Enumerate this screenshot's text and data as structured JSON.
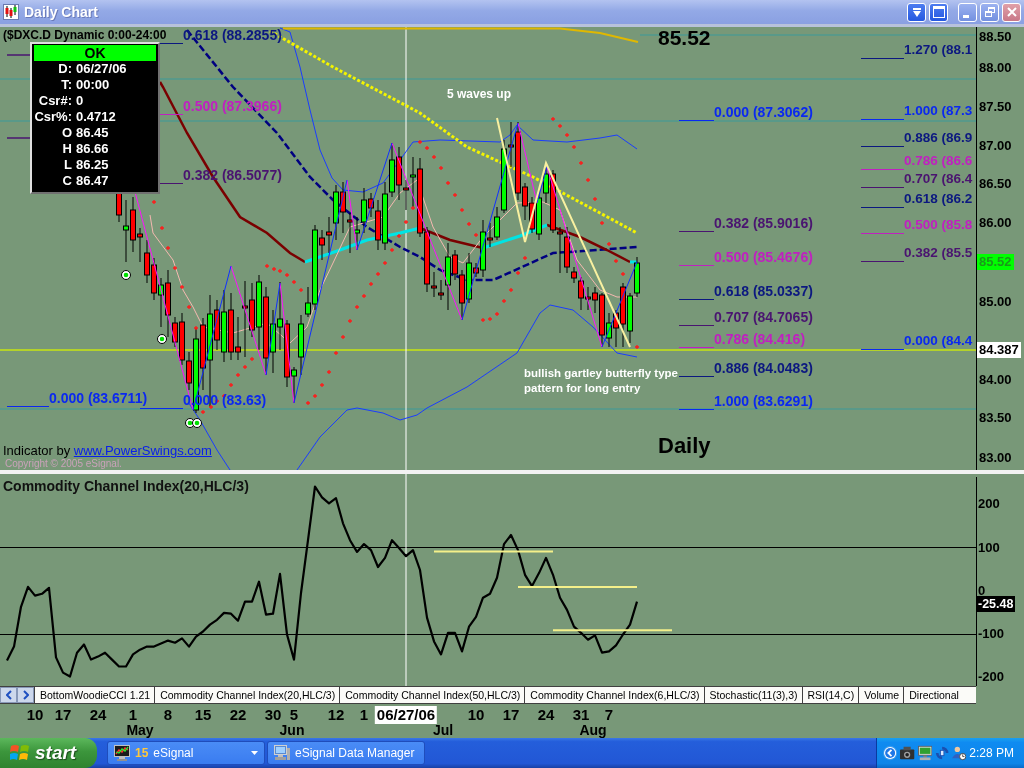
{
  "window": {
    "title": "Daily Chart"
  },
  "price_pane": {
    "symbol": "($DXC.D Dynamic 0:00-24:00",
    "last_price_label": "85.52",
    "data_window": {
      "header": "OK",
      "rows": [
        {
          "label": "D:",
          "value": "06/27/06"
        },
        {
          "label": "T:",
          "value": "00:00"
        },
        {
          "label": "Csr#:",
          "value": "0"
        },
        {
          "label": "Csr%:",
          "value": "0.4712"
        },
        {
          "label": "O",
          "value": "86.45"
        },
        {
          "label": "H",
          "value": "86.66"
        },
        {
          "label": "L",
          "value": "86.25"
        },
        {
          "label": "C",
          "value": "86.47"
        }
      ]
    },
    "fib_sets": [
      {
        "levels": [
          {
            "text": "0.618 (88.2855)",
            "color": "#0c1880"
          },
          {
            "text": "0.500 (87.3966)",
            "color": "#c020c0"
          },
          {
            "text": "0.382 (86.5077)",
            "color": "#4a1470"
          }
        ]
      },
      {
        "levels": [
          {
            "text": "0.000 (83.6711)",
            "color": "#0a28f0"
          }
        ]
      },
      {
        "levels": [
          {
            "text": "0.000 (83.63)",
            "color": "#0a28f0"
          }
        ]
      },
      {
        "levels": [
          {
            "text": "0.000 (87.3062)",
            "color": "#0a28f0"
          },
          {
            "text": "0.382 (85.9016)",
            "color": "#4a1470"
          },
          {
            "text": "0.500 (85.4676)",
            "color": "#c020c0"
          },
          {
            "text": "0.618 (85.0337)",
            "color": "#0c1880"
          },
          {
            "text": "0.707 (84.7065)",
            "color": "#4a1470"
          },
          {
            "text": "0.786 (84.416)",
            "color": "#c020c0"
          },
          {
            "text": "0.886 (84.0483)",
            "color": "#0c1880"
          },
          {
            "text": "1.000 (83.6291)",
            "color": "#0a28f0"
          }
        ]
      },
      {
        "levels": [
          {
            "text": "1.270 (88.1",
            "color": "#0c1880"
          },
          {
            "text": "1.000 (87.3",
            "color": "#0a28f0"
          },
          {
            "text": "0.886 (86.9",
            "color": "#0c1880"
          },
          {
            "text": "0.786 (86.6",
            "color": "#c020c0"
          },
          {
            "text": "0.707 (86.4",
            "color": "#4a1470"
          },
          {
            "text": "0.618 (86.2",
            "color": "#0c1880"
          },
          {
            "text": "0.500 (85.8",
            "color": "#c020c0"
          },
          {
            "text": "0.382 (85.5",
            "color": "#4a1470"
          },
          {
            "text": "0.000 (84.4",
            "color": "#0a28f0"
          }
        ]
      }
    ],
    "notes": [
      "5 waves up",
      "bullish gartley butterfly type pattern for long entry"
    ],
    "period_label": "Daily",
    "credit": {
      "text": "Indicator by",
      "link": "www.PowerSwings.com"
    },
    "copyright": "Copyright © 2005 eSignal.",
    "axis": {
      "ticks": [
        "88.50",
        "88.00",
        "87.50",
        "87.00",
        "86.50",
        "86.00",
        "85.00",
        "84.00",
        "83.50",
        "83.00"
      ],
      "last_price": "85.52",
      "level_price": "84.387"
    }
  },
  "cci_pane": {
    "axis": {
      "last_value": "-25.48"
    },
    "chart_data": {
      "type": "line",
      "title": "Commodity Channel Index(20,HLC/3)",
      "categories": [
        null,
        null,
        null,
        null,
        "10",
        null,
        null,
        null,
        "17",
        null,
        null,
        null,
        null,
        "24",
        null,
        null,
        null,
        null,
        "1",
        null,
        null,
        null,
        null,
        "8",
        null,
        null,
        null,
        null,
        "15",
        null,
        null,
        null,
        null,
        "22",
        null,
        null,
        null,
        null,
        "30",
        null,
        null,
        "5",
        null,
        null,
        null,
        null,
        null,
        "12",
        null,
        null,
        null,
        "1",
        null,
        null,
        null,
        null,
        null,
        null,
        null,
        null,
        null,
        null,
        null,
        null,
        null,
        null,
        null,
        "10",
        null,
        null,
        null,
        null,
        "17",
        null,
        null,
        null,
        null,
        "24",
        null,
        null,
        null,
        null,
        "31",
        null,
        null,
        null,
        "7",
        null,
        null,
        null,
        null,
        null,
        null,
        null,
        null,
        null
      ],
      "series": [
        {
          "color": "#000000",
          "values": [
            -161,
            -129,
            -37,
            9,
            -11,
            -7,
            7,
            -154,
            -189,
            -198,
            -143,
            -124,
            -159,
            -152,
            -143,
            -159,
            -175,
            -175,
            -147,
            -136,
            -129,
            -129,
            -122,
            -115,
            -120,
            -110,
            -129,
            -106,
            -94,
            -78,
            -67,
            -51,
            -53,
            -69,
            -25,
            -25,
            21,
            -55,
            -53,
            39,
            -101,
            -159,
            -5,
            117,
            241,
            216,
            202,
            214,
            156,
            117,
            90,
            108,
            94,
            55,
            76,
            117,
            99,
            80,
            94,
            48,
            -62,
            -117,
            -147,
            -97,
            -97,
            -140,
            -83,
            -60,
            -16,
            -7,
            30,
            108,
            129,
            94,
            37,
            11,
            41,
            76,
            37,
            -16,
            -44,
            -83,
            -97,
            -113,
            -103,
            -143,
            -140,
            -126,
            -101,
            -78,
            -25,
            null,
            null,
            null,
            null,
            null
          ]
        },
        {
          "color": "#f4f08a",
          "values": [
            null,
            null,
            null,
            null,
            null,
            null,
            null,
            null,
            null,
            null,
            null,
            null,
            null,
            null,
            null,
            null,
            null,
            null,
            null,
            null,
            null,
            null,
            null,
            null,
            null,
            null,
            null,
            null,
            null,
            null,
            null,
            null,
            null,
            null,
            null,
            null,
            null,
            null,
            null,
            null,
            null,
            null,
            null,
            null,
            null,
            null,
            null,
            null,
            null,
            null,
            null,
            null,
            null,
            null,
            null,
            null,
            null,
            null,
            null,
            null,
            null,
            91,
            91,
            91,
            91,
            91,
            91,
            91,
            91,
            91,
            91,
            91,
            91,
            91,
            91,
            91,
            91,
            91,
            91,
            null,
            null,
            null,
            null,
            null,
            null,
            null,
            null,
            null,
            null,
            null,
            null,
            null,
            null,
            null,
            null,
            null
          ]
        },
        {
          "color": "#f4f08a",
          "values": [
            null,
            null,
            null,
            null,
            null,
            null,
            null,
            null,
            null,
            null,
            null,
            null,
            null,
            null,
            null,
            null,
            null,
            null,
            null,
            null,
            null,
            null,
            null,
            null,
            null,
            null,
            null,
            null,
            null,
            null,
            null,
            null,
            null,
            null,
            null,
            null,
            null,
            null,
            null,
            null,
            null,
            null,
            null,
            null,
            null,
            null,
            null,
            null,
            null,
            null,
            null,
            null,
            null,
            null,
            null,
            null,
            null,
            null,
            null,
            null,
            null,
            null,
            null,
            null,
            null,
            null,
            null,
            null,
            null,
            null,
            null,
            null,
            null,
            9,
            9,
            9,
            9,
            9,
            9,
            9,
            9,
            9,
            9,
            9,
            9,
            9,
            9,
            9,
            9,
            9,
            9,
            null,
            null,
            null,
            null,
            null
          ]
        },
        {
          "color": "#f4f08a",
          "values": [
            null,
            null,
            null,
            null,
            null,
            null,
            null,
            null,
            null,
            null,
            null,
            null,
            null,
            null,
            null,
            null,
            null,
            null,
            null,
            null,
            null,
            null,
            null,
            null,
            null,
            null,
            null,
            null,
            null,
            null,
            null,
            null,
            null,
            null,
            null,
            null,
            null,
            null,
            null,
            null,
            null,
            null,
            null,
            null,
            null,
            null,
            null,
            null,
            null,
            null,
            null,
            null,
            null,
            null,
            null,
            null,
            null,
            null,
            null,
            null,
            null,
            null,
            null,
            null,
            null,
            null,
            null,
            null,
            null,
            null,
            null,
            null,
            null,
            null,
            null,
            null,
            null,
            null,
            -91,
            -91,
            -91,
            -91,
            -91,
            -91,
            -91,
            -91,
            -91,
            -91,
            -91,
            -91,
            -91,
            -91,
            -91,
            -91,
            -91,
            -91
          ]
        }
      ],
      "ylim": [
        -220,
        270
      ],
      "yticks": [
        {
          "value": 200,
          "label": "200"
        },
        {
          "value": 100,
          "label": "100"
        },
        {
          "value": 0,
          "label": "0"
        },
        {
          "value": -100,
          "label": "-100"
        },
        {
          "value": -200,
          "label": "-200"
        }
      ]
    }
  },
  "indicator_tabs": [
    "BottomWoodieCCI 1.21",
    "Commodity Channel Index(20,HLC/3)",
    "Commodity Channel Index(50,HLC/3)",
    "Commodity Channel Index(6,HLC/3)",
    "Stochastic(11(3),3)",
    "RSI(14,C)",
    "Volume",
    "Directional"
  ],
  "date_axis": {
    "months": [
      "May",
      "Jun",
      "Jul",
      "Aug"
    ],
    "cursor_date": "06/27/06"
  },
  "taskbar": {
    "start_label": "start",
    "tasks": [
      {
        "kind": "group",
        "count": "15",
        "label": "eSignal"
      },
      {
        "kind": "window",
        "label": "eSignal Data Manager"
      }
    ],
    "clock": "2:28 PM"
  }
}
